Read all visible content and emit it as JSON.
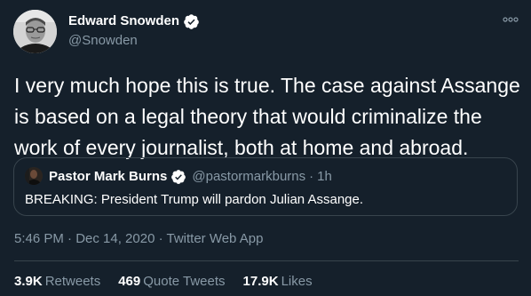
{
  "author": {
    "name": "Edward Snowden",
    "handle": "@Snowden"
  },
  "tweet": {
    "text": "I very much hope this is true. The case against Assange is based on a legal theory that would criminalize the work of every journalist, both at home and abroad."
  },
  "quoted_tweet": {
    "name": "Pastor Mark Burns",
    "handle": "@pastormarkburns",
    "separator": "·",
    "age": "1h",
    "text": "BREAKING: President Trump will pardon Julian Assange."
  },
  "meta": {
    "timestamp": "5:46 PM · Dec 14, 2020 · Twitter Web App"
  },
  "stats": {
    "retweets_count": "3.9K",
    "retweets_label": "Retweets",
    "quote_tweets_count": "469",
    "quote_tweets_label": "Quote Tweets",
    "likes_count": "17.9K",
    "likes_label": "Likes"
  },
  "colors": {
    "background": "#15202b",
    "secondary_text": "#8899a6",
    "border": "#38444d"
  },
  "icons": {
    "verified": "verified-badge-icon",
    "more": "more-options-icon"
  }
}
